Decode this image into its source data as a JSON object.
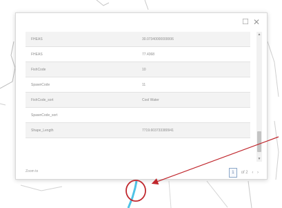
{
  "colors": {
    "popup_background": "#ffffff",
    "row_shaded": "#f3f3f3",
    "row_plain": "#ffffff",
    "text_muted": "#8c8c8c",
    "annotation_red": "#c0272d",
    "feature_cyan": "#4fc3e6"
  },
  "popup": {
    "header": {
      "maximize_icon": "maximize-icon",
      "close_icon": "close-icon"
    },
    "attributes": [
      {
        "key": "FHEAS",
        "value": "30.07340000000006"
      },
      {
        "key": "FHEAS",
        "value": "77.4368"
      },
      {
        "key": "FishCode",
        "value": "10"
      },
      {
        "key": "SpawnCode",
        "value": "11"
      },
      {
        "key": "FishCode_sort",
        "value": "Cool Water"
      },
      {
        "key": "SpawnCode_sort",
        "value": ""
      },
      {
        "key": "Shape_Length",
        "value": "7719.603733380941"
      }
    ],
    "footer": {
      "zoom_label": "Zoom to",
      "page_current": "1",
      "page_separator": "of 2",
      "prev_icon": "chevron-left-icon",
      "next_icon": "chevron-right-icon"
    }
  }
}
